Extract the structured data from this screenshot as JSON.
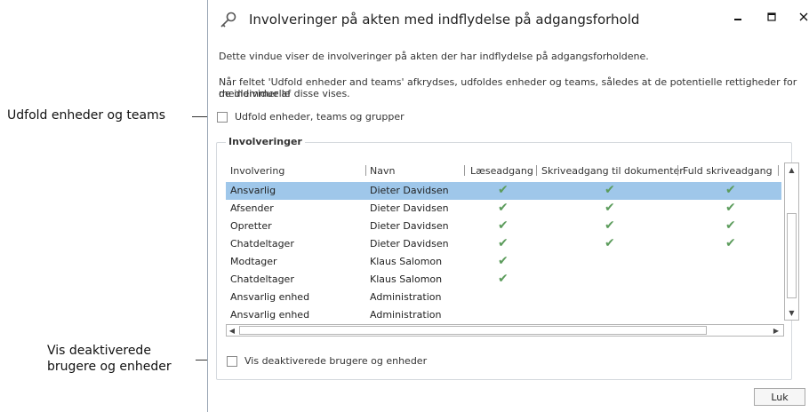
{
  "callouts": {
    "udfold": "Udfold enheder og teams",
    "vis_line1": "Vis deaktiverede",
    "vis_line2": "brugere og enheder"
  },
  "dialog": {
    "title": "Involveringer på akten med indflydelse på adgangsforhold",
    "icon": "key-icon",
    "window_controls": {
      "minimize": "–",
      "maximize": "□",
      "close": "×"
    },
    "info_line1": "Dette vindue viser de involveringer på akten der har indflydelse på adgangsforholdene.",
    "info_line2": "Når feltet 'Udfold enheder and teams' afkrydses, udfoldes enheder og teams, således at de potentielle rettigheder for de individuelle",
    "info_line3": "medlemmer af disse vises.",
    "expand_checkbox": {
      "label": "Udfold enheder, teams og grupper",
      "checked": false
    },
    "group_label": "Involveringer",
    "table": {
      "columns": [
        "Involvering",
        "Navn",
        "Læseadgang",
        "Skriveadgang til dokumenter",
        "Fuld skriveadgang"
      ],
      "rows": [
        {
          "involvering": "Ansvarlig",
          "navn": "Dieter Davidsen",
          "laes": true,
          "skriv": true,
          "fuld": true,
          "selected": true
        },
        {
          "involvering": "Afsender",
          "navn": "Dieter Davidsen",
          "laes": true,
          "skriv": true,
          "fuld": true,
          "selected": false
        },
        {
          "involvering": "Opretter",
          "navn": "Dieter Davidsen",
          "laes": true,
          "skriv": true,
          "fuld": true,
          "selected": false
        },
        {
          "involvering": "Chatdeltager",
          "navn": "Dieter Davidsen",
          "laes": true,
          "skriv": true,
          "fuld": true,
          "selected": false
        },
        {
          "involvering": "Modtager",
          "navn": "Klaus Salomon",
          "laes": true,
          "skriv": false,
          "fuld": false,
          "selected": false
        },
        {
          "involvering": "Chatdeltager",
          "navn": "Klaus Salomon",
          "laes": true,
          "skriv": false,
          "fuld": false,
          "selected": false
        },
        {
          "involvering": "Ansvarlig enhed",
          "navn": "Administration",
          "laes": false,
          "skriv": false,
          "fuld": false,
          "selected": false
        },
        {
          "involvering": "Ansvarlig enhed",
          "navn": "Administration",
          "laes": false,
          "skriv": false,
          "fuld": false,
          "selected": false
        }
      ],
      "check_glyph": "✔"
    },
    "deactivated_checkbox": {
      "label": "Vis deaktiverede brugere og enheder",
      "checked": false
    },
    "close_button": "Luk",
    "colors": {
      "selection": "#9fc7ea",
      "check": "#5c9c5c"
    }
  }
}
